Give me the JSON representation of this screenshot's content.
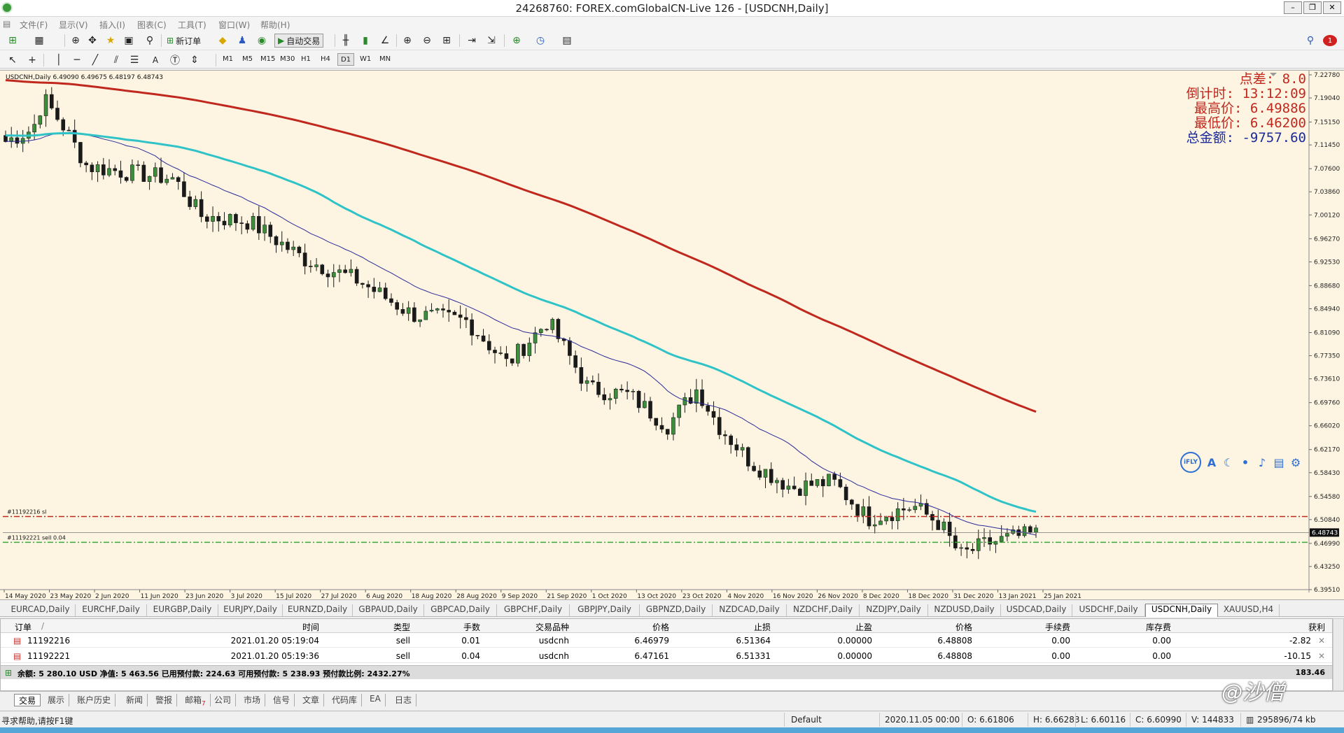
{
  "window": {
    "title": "24268760: FOREX.comGlobalCN-Live 126 - [USDCNH,Daily]"
  },
  "menu": [
    "文件(F)",
    "显示(V)",
    "插入(I)",
    "图表(C)",
    "工具(T)",
    "窗口(W)",
    "帮助(H)"
  ],
  "toolbar": {
    "new_order": "新订单",
    "auto_trade": "自动交易"
  },
  "timeframes": [
    "M1",
    "M5",
    "M15",
    "M30",
    "H1",
    "H4",
    "D1",
    "W1",
    "MN"
  ],
  "chart": {
    "header": "USDCNH,Daily  6.49090 6.49675 6.48197 6.48743",
    "info": {
      "spread": "点差:  8.0",
      "countdown": "倒计时:  13:12:09",
      "high": "最高价:  6.49886",
      "low": "最低价:  6.46200",
      "total": "总金额:  -9757.60"
    },
    "price_labels": [
      "7.22780",
      "7.19040",
      "7.15150",
      "7.11450",
      "7.07600",
      "7.03860",
      "7.00120",
      "6.96270",
      "6.92530",
      "6.88680",
      "6.84940",
      "6.81090",
      "6.77350",
      "6.73610",
      "6.69760",
      "6.66020",
      "6.62170",
      "6.58430",
      "6.54580",
      "6.50840",
      "6.46990",
      "6.43250",
      "6.39510"
    ],
    "current_price": "6.48743",
    "date_labels": [
      "14 May 2020",
      "23 May 2020",
      "2 Jun 2020",
      "11 Jun 2020",
      "23 Jun 2020",
      "3 Jul 2020",
      "15 Jul 2020",
      "27 Jul 2020",
      "6 Aug 2020",
      "18 Aug 2020",
      "28 Aug 2020",
      "9 Sep 2020",
      "21 Sep 2020",
      "1 Oct 2020",
      "13 Oct 2020",
      "23 Oct 2020",
      "4 Nov 2020",
      "16 Nov 2020",
      "26 Nov 2020",
      "8 Dec 2020",
      "18 Dec 2020",
      "31 Dec 2020",
      "13 Jan 2021",
      "25 Jan 2021"
    ],
    "sl_label": "#11192216 sl",
    "order_label": "#11192221 sell 0.04"
  },
  "chart_data": {
    "type": "candlestick",
    "symbol": "USDCNH",
    "timeframe": "Daily",
    "ylim": [
      6.3951,
      7.2278
    ],
    "open": 6.4909,
    "high": 6.49675,
    "low": 6.48197,
    "close": 6.48743,
    "stop_loss_level": 6.5134,
    "order_level": 6.47161
  },
  "symbol_tabs": [
    "EURCAD,Daily",
    "EURCHF,Daily",
    "EURGBP,Daily",
    "EURJPY,Daily",
    "EURNZD,Daily",
    "GBPAUD,Daily",
    "GBPCAD,Daily",
    "GBPCHF,Daily",
    "GBPJPY,Daily",
    "GBPNZD,Daily",
    "NZDCAD,Daily",
    "NZDCHF,Daily",
    "NZDJPY,Daily",
    "NZDUSD,Daily",
    "USDCAD,Daily",
    "USDCHF,Daily",
    "USDCNH,Daily",
    "XAUUSD,H4"
  ],
  "terminal": {
    "headers": [
      "订单",
      "/",
      "时间",
      "类型",
      "手数",
      "交易品种",
      "价格",
      "止损",
      "止盈",
      "价格",
      "手续费",
      "库存费",
      "获利"
    ],
    "rows": [
      [
        "11192216",
        "2021.01.20 05:19:04",
        "sell",
        "0.01",
        "usdcnh",
        "6.46979",
        "6.51364",
        "0.00000",
        "6.48808",
        "0.00",
        "0.00",
        "-2.82"
      ],
      [
        "11192221",
        "2021.01.20 05:19:36",
        "sell",
        "0.04",
        "usdcnh",
        "6.47161",
        "6.51331",
        "0.00000",
        "6.48808",
        "0.00",
        "0.00",
        "-10.15"
      ]
    ],
    "balance": "余额: 5 280.10 USD  净值: 5 463.56  已用预付款: 224.63  可用预付款: 5 238.93  预付款比例: 2432.27%",
    "total": "183.46"
  },
  "bottom_tabs": [
    "交易",
    "展示",
    "账户历史",
    "新闻",
    "警报",
    "邮箱",
    "公司",
    "市场",
    "信号",
    "文章",
    "代码库",
    "EA",
    "日志"
  ],
  "mail_count": "7",
  "status": {
    "help": "寻求帮助,请按F1键",
    "profile": "Default",
    "time": "2020.11.05 00:00",
    "open": "O: 6.61806",
    "high": "H: 6.66283",
    "low": "L: 6.60116",
    "close": "C: 6.60990",
    "volume": "V: 144833",
    "traffic": "295896/74 kb"
  },
  "ifly": {
    "logo": "iFLY",
    "a": "A"
  },
  "watermark": "@沙僧",
  "colors": {
    "chart_bg": "#fdf5e2",
    "bull": "#3b8f3b",
    "bear": "#1a1a1a",
    "ma_fast": "#2a2a9a",
    "ma_mid": "#2fc3c8",
    "ma_slow": "#c0281e",
    "sl_line": "#c0281e",
    "order_line": "#3aa83a"
  }
}
